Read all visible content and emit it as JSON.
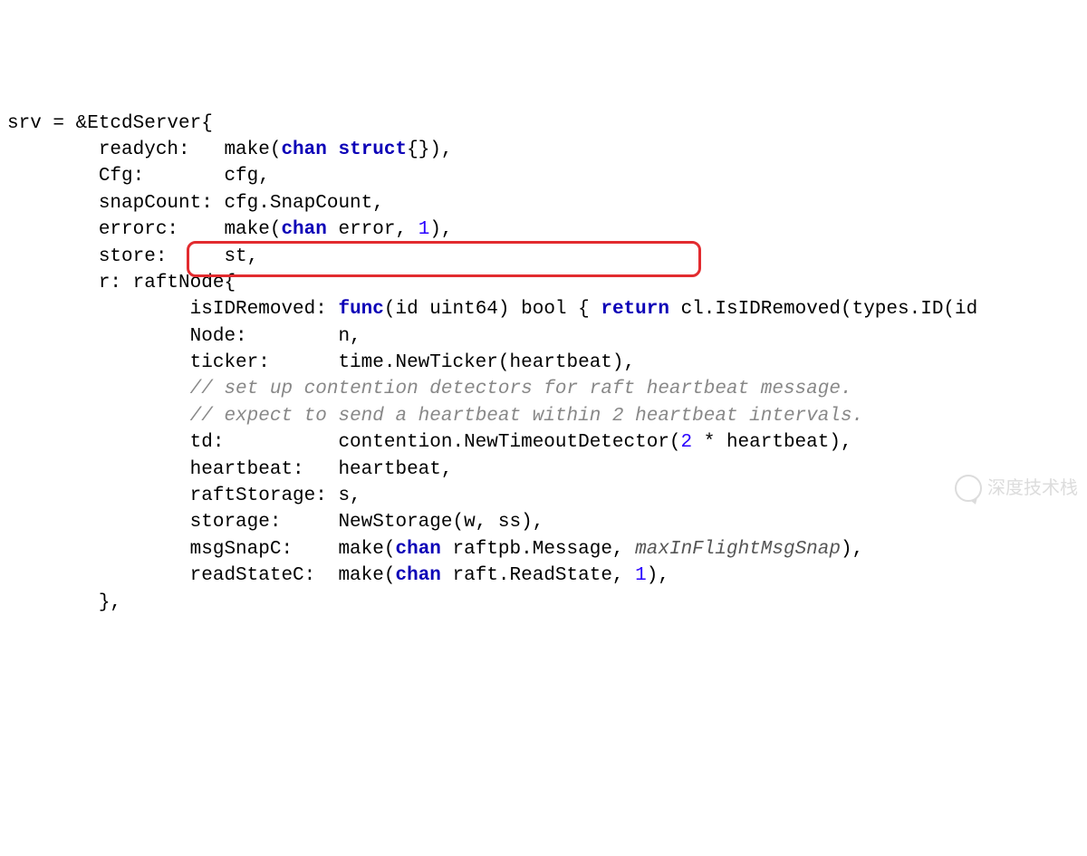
{
  "code": {
    "l1_a": "srv = &EtcdServer{",
    "l2_a": "        readych:   make(",
    "l2_kw1": "chan",
    "l2_b": " ",
    "l2_kw2": "struct",
    "l2_c": "{}),",
    "l3_a": "        Cfg:       cfg,",
    "l4_a": "        snapCount: cfg.SnapCount,",
    "l5_a": "        errorc:    make(",
    "l5_kw1": "chan",
    "l5_b": " error, ",
    "l5_num": "1",
    "l5_c": "),",
    "l6_a": "        store:     st,",
    "l7_a": "        r: raftNode{",
    "l8_a": "                isIDRemoved: ",
    "l8_kw1": "func",
    "l8_b": "(id uint64) bool { ",
    "l8_kw2": "return",
    "l8_c": " cl.IsIDRemoved(types.ID(id",
    "l9_a": "                Node:        n,",
    "l10_a": "                ticker:      time.NewTicker(heartbeat),",
    "l11_a": "                ",
    "l11_comment": "// set up contention detectors for raft heartbeat message.",
    "l12_a": "                ",
    "l12_comment": "// expect to send a heartbeat within 2 heartbeat intervals.",
    "l13_a": "                td:          contention.NewTimeoutDetector(",
    "l13_num": "2",
    "l13_b": " * heartbeat),",
    "l14_a": "                heartbeat:   heartbeat,",
    "l15_a": "                raftStorage: s,",
    "l16_a": "                storage:     NewStorage(w, ss),",
    "l17_a": "                msgSnapC:    make(",
    "l17_kw1": "chan",
    "l17_b": " raftpb.Message, ",
    "l17_ident": "maxInFlightMsgSnap",
    "l17_c": "),",
    "l18_a": "                readStateC:  make(",
    "l18_kw1": "chan",
    "l18_b": " raft.ReadState, ",
    "l18_num": "1",
    "l18_c": "),",
    "l19_a": "        },"
  },
  "watermark_text": "深度技术栈"
}
